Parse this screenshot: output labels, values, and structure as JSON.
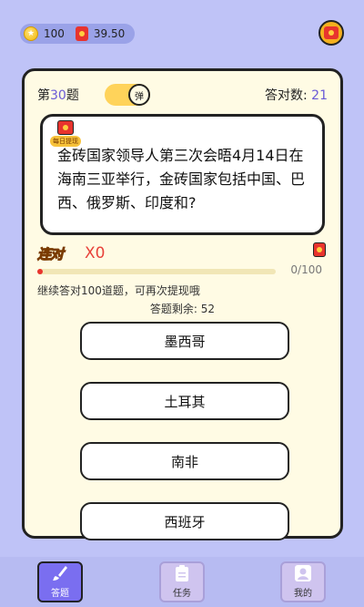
{
  "wallet": {
    "coins": "100",
    "cash": "39.50"
  },
  "question": {
    "prefix": "第",
    "number": "30",
    "suffix": "题",
    "toggle_label": "弹",
    "correct_label": "答对数:",
    "correct_count": "21",
    "daily_badge": "每日提现",
    "text": "金砖国家领导人第三次会晤4月14日在海南三亚举行，金砖国家包括中国、巴西、俄罗斯、印度和?"
  },
  "streak": {
    "logo": "连对",
    "count": "X0",
    "progress_label": "0/100",
    "progress_value": 0.0,
    "hint": "继续答对100道题，可再次提现哦",
    "remaining": "答题剩余: 52"
  },
  "options": [
    {
      "label": "墨西哥"
    },
    {
      "label": "土耳其"
    },
    {
      "label": "南非"
    },
    {
      "label": "西班牙"
    }
  ],
  "nav": [
    {
      "label": "答题",
      "active": true
    },
    {
      "label": "任务",
      "active": false
    },
    {
      "label": "我的",
      "active": false
    }
  ],
  "colors": {
    "accent": "#7a6ef0",
    "red": "#e8342e",
    "gold": "#f4b01e",
    "background": "#bfc3f7"
  }
}
